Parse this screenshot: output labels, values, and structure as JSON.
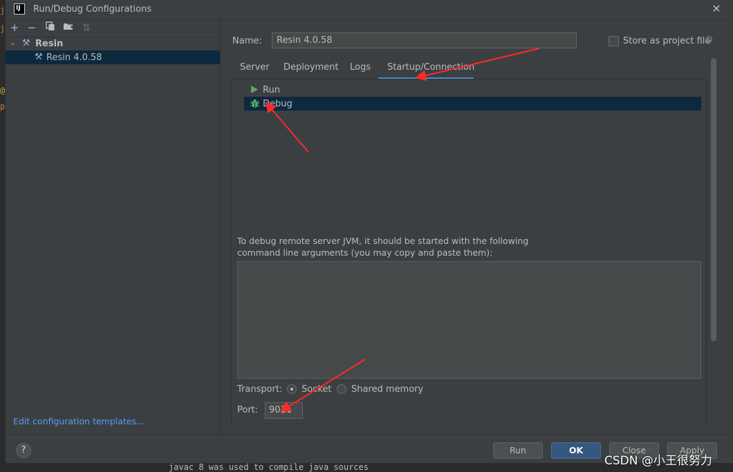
{
  "window": {
    "title": "Run/Debug Configurations",
    "app_icon": "IJ"
  },
  "left_panel": {
    "toolbar_icons": [
      "add-icon",
      "remove-icon",
      "copy-icon",
      "folder-icon",
      "sort-icon"
    ],
    "tree": {
      "group_label": "Resin",
      "child_label": "Resin 4.0.58"
    },
    "edit_templates_link": "Edit configuration templates..."
  },
  "form": {
    "name_label": "Name:",
    "name_value": "Resin 4.0.58",
    "store_as_project_file": "Store as project file",
    "store_checked": false
  },
  "tabs": [
    {
      "label": "Server"
    },
    {
      "label": "Deployment"
    },
    {
      "label": "Logs"
    },
    {
      "label": "Startup/Connection",
      "selected": true
    }
  ],
  "startup": {
    "items": [
      {
        "label": "Run",
        "icon": "run-triangle-icon"
      },
      {
        "label": "Debug",
        "icon": "debug-bug-icon",
        "selected": true
      }
    ],
    "info_line1": "To debug remote server JVM, it should be started with the following",
    "info_line2": "command line arguments (you may copy and paste them):",
    "args_value": "",
    "transport_label": "Transport:",
    "transport_options": [
      {
        "label": "Socket",
        "selected": true
      },
      {
        "label": "Shared memory",
        "selected": false
      }
    ],
    "port_label": "Port:",
    "port_value": "9011"
  },
  "buttons": {
    "help": "?",
    "run": "Run",
    "ok": "OK",
    "close": "Close",
    "apply": "Apply"
  },
  "background": {
    "console_text": "javac 8 was used to compile java sources",
    "watermark": "CSDN @小王很努力"
  },
  "colors": {
    "accent": "#4a88c7",
    "selection": "#0d293e",
    "link": "#589df6",
    "annotation_arrow": "#ff2a2a",
    "run_green": "#59a869"
  }
}
